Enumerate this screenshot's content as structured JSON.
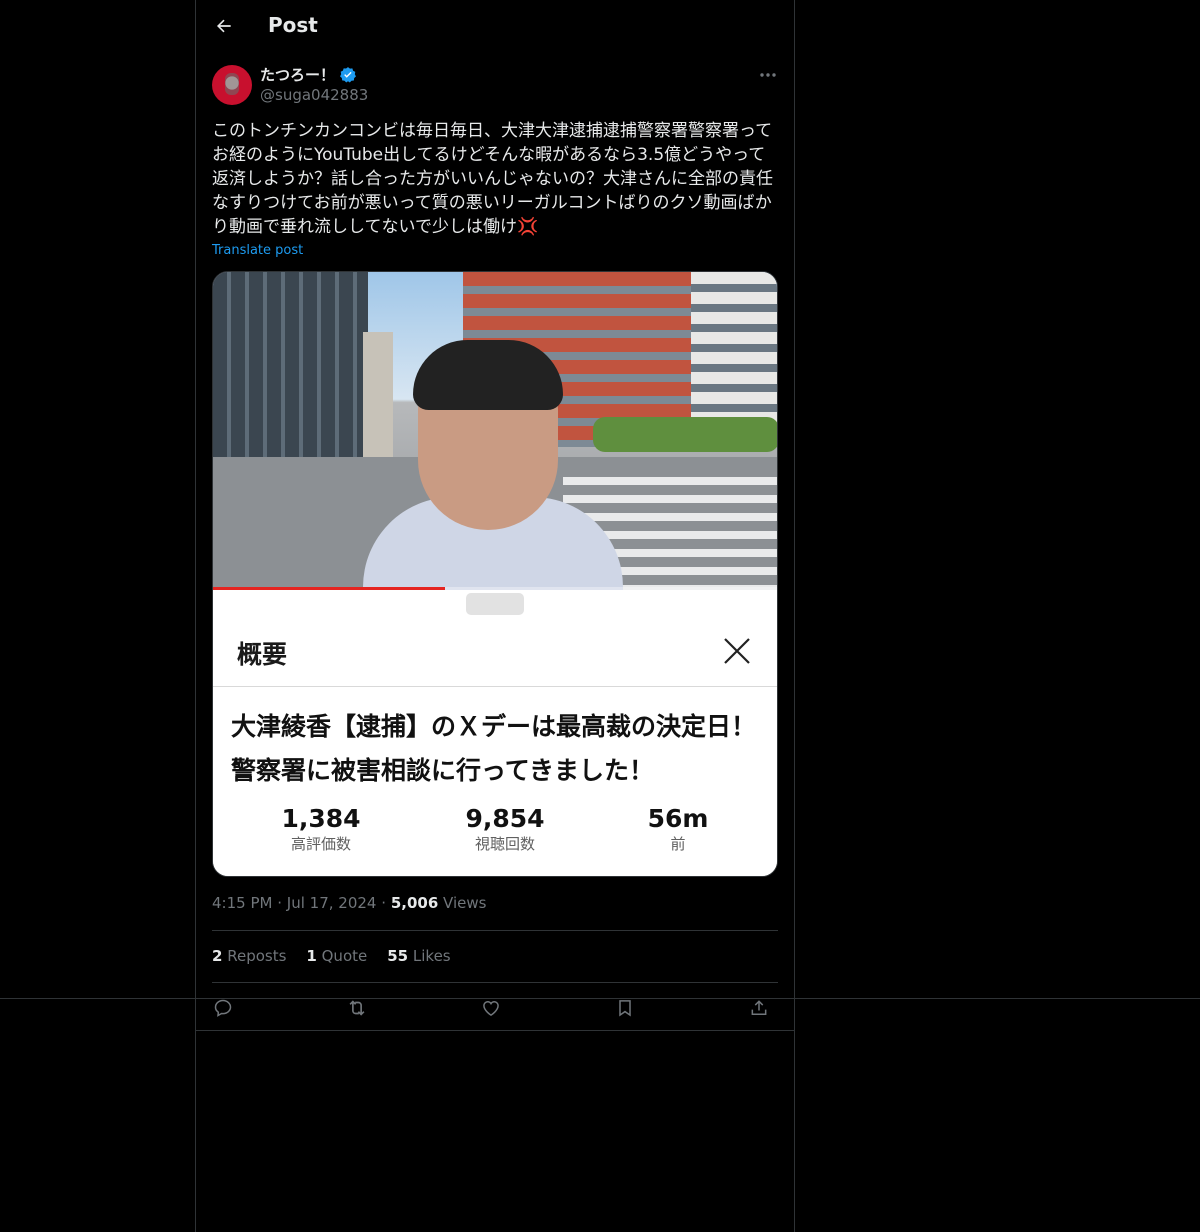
{
  "header": {
    "title": "Post"
  },
  "author": {
    "display_name": "たつろー！",
    "handle": "@suga042883"
  },
  "post": {
    "text": "このトンチンカンコンビは毎日毎日、大津大津逮捕逮捕警察署警察署ってお経のようにYouTube出してるけどそんな暇があるなら3.5億どうやって返済しようか？話し合った方がいいんじゃないの？大津さんに全部の責任なすりつけてお前が悪いって質の悪いリーガルコントばりのクソ動画ばかり動画で垂れ流ししてないで少しは働け💢",
    "translate_label": "Translate post"
  },
  "media": {
    "progress": 0.41,
    "sheet_title": "概要",
    "video_title": "大津綾香【逮捕】のＸデーは最高裁の決定日！警察署に被害相談に行ってきました！",
    "stats": [
      {
        "value": "1,384",
        "label": "高評価数"
      },
      {
        "value": "9,854",
        "label": "視聴回数"
      },
      {
        "value": "56m",
        "label": "前"
      }
    ]
  },
  "meta": {
    "time": "4:15 PM",
    "dot1": "·",
    "date": "Jul 17, 2024",
    "dot2": "·",
    "views_count": "5,006",
    "views_label": "Views"
  },
  "engagement": {
    "reposts_count": "2",
    "reposts_label": "Reposts",
    "quotes_count": "1",
    "quotes_label": "Quote",
    "likes_count": "55",
    "likes_label": "Likes"
  },
  "colors": {
    "accent": "#1d9bf0",
    "verified": "#1d9bf0",
    "progress": "#e52521",
    "muted": "#71767b"
  },
  "icons": [
    "back-arrow-icon",
    "verified-badge-icon",
    "more-icon",
    "close-icon",
    "reply-icon",
    "repost-icon",
    "like-icon",
    "bookmark-icon",
    "share-icon"
  ]
}
